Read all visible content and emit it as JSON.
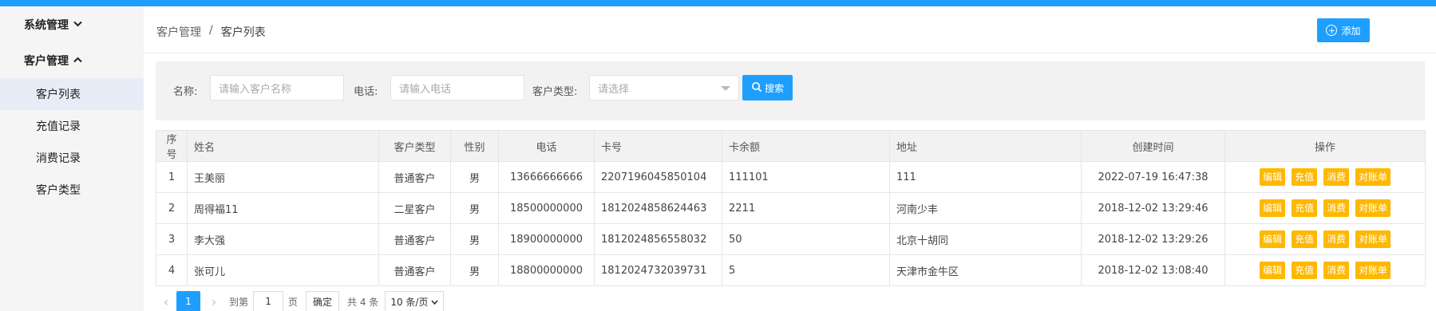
{
  "sidebar": {
    "groups": [
      {
        "label": "系统管理",
        "chevron": "chevron-down-icon"
      },
      {
        "label": "客户管理",
        "chevron": "chevron-up-icon"
      }
    ],
    "items": [
      {
        "label": "客户列表",
        "active": true
      },
      {
        "label": "充值记录"
      },
      {
        "label": "消费记录"
      },
      {
        "label": "客户类型"
      }
    ]
  },
  "breadcrumb": {
    "parent": "客户管理",
    "separator": "/",
    "current": "客户列表"
  },
  "toolbar": {
    "add_label": "添加",
    "add_icon": "plus-circle-icon"
  },
  "search": {
    "name_label": "名称:",
    "name_placeholder": "请输入客户名称",
    "phone_label": "电话:",
    "phone_placeholder": "请输入电话",
    "type_label": "客户类型:",
    "type_placeholder": "请选择",
    "button_label": "搜索",
    "button_icon": "search-icon"
  },
  "table": {
    "headers": [
      "序号",
      "姓名",
      "客户类型",
      "性别",
      "电话",
      "卡号",
      "卡余额",
      "地址",
      "创建时间",
      "操作"
    ],
    "rows": [
      {
        "no": "1",
        "name": "王美丽",
        "type": "普通客户",
        "gender": "男",
        "phone": "13666666666",
        "card": "2207196045850104",
        "balance": "111101",
        "address": "111",
        "created": "2022-07-19 16:47:38"
      },
      {
        "no": "2",
        "name": "周得福11",
        "type": "二星客户",
        "gender": "男",
        "phone": "18500000000",
        "card": "1812024858624463",
        "balance": "2211",
        "address": "河南少丰",
        "created": "2018-12-02 13:29:46"
      },
      {
        "no": "3",
        "name": "李大强",
        "type": "普通客户",
        "gender": "男",
        "phone": "18900000000",
        "card": "1812024856558032",
        "balance": "50",
        "address": "北京十胡同",
        "created": "2018-12-02 13:29:26"
      },
      {
        "no": "4",
        "name": "张可儿",
        "type": "普通客户",
        "gender": "男",
        "phone": "18800000000",
        "card": "1812024732039731",
        "balance": "5",
        "address": "天津市金牛区",
        "created": "2018-12-02 13:08:40"
      }
    ],
    "actions": [
      "编辑",
      "充值",
      "消费",
      "对账单"
    ]
  },
  "pagination": {
    "prev": "‹",
    "current": "1",
    "next": "›",
    "goto_label": "到第",
    "goto_value": "1",
    "page_unit": "页",
    "confirm": "确定",
    "total": "共 4 条",
    "page_size": "10 条/页"
  },
  "colors": {
    "primary": "#1e9fff",
    "warning": "#ffb800"
  }
}
